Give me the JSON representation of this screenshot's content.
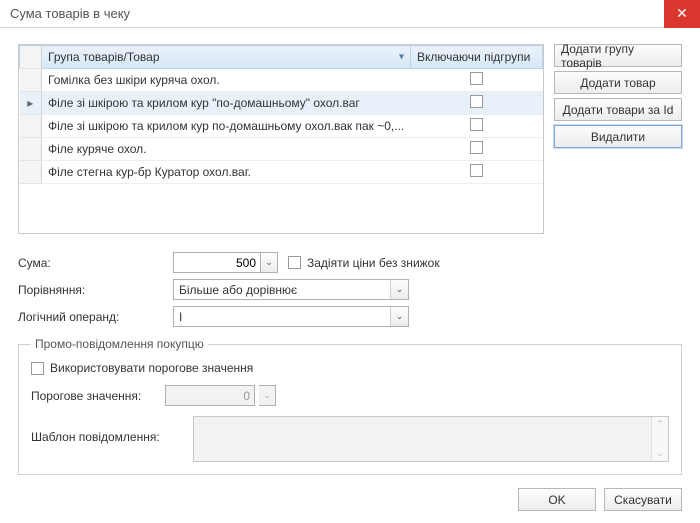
{
  "window": {
    "title": "Сума товарів в чеку"
  },
  "table": {
    "headers": {
      "group": "Група товарів/Товар",
      "include": "Включаючи підгрупи"
    },
    "rows": [
      {
        "label": "Гомілка без шкіри куряча охол.",
        "selected": false
      },
      {
        "label": "Філе зі шкірою та крилом кур \"по-домашньому\" охол.ваг",
        "selected": true
      },
      {
        "label": "Філе зі шкірою та крилом кур по-домашньому охол.вак пак ~0,...",
        "selected": false
      },
      {
        "label": "Філе куряче охол.",
        "selected": false
      },
      {
        "label": "Філе стегна кур-бр Куратор охол.ваг.",
        "selected": false
      }
    ]
  },
  "side_buttons": {
    "add_group": "Додати групу товарів",
    "add_item": "Додати товар",
    "add_by_id": "Додати товари за Id",
    "delete": "Видалити"
  },
  "form": {
    "sum_label": "Сума:",
    "sum_value": "500",
    "discount_checkbox": "Задіяти ціни без знижок",
    "compare_label": "Порівняння:",
    "compare_value": "Більше або дорівнює",
    "operand_label": "Логічний операнд:",
    "operand_value": "І"
  },
  "promo": {
    "legend": "Промо-повідомлення покупцю",
    "use_threshold": "Використовувати порогове значення",
    "threshold_label": "Порогове значення:",
    "threshold_value": "0",
    "template_label": "Шаблон повідомлення:"
  },
  "footer": {
    "ok": "OK",
    "cancel": "Скасувати"
  }
}
